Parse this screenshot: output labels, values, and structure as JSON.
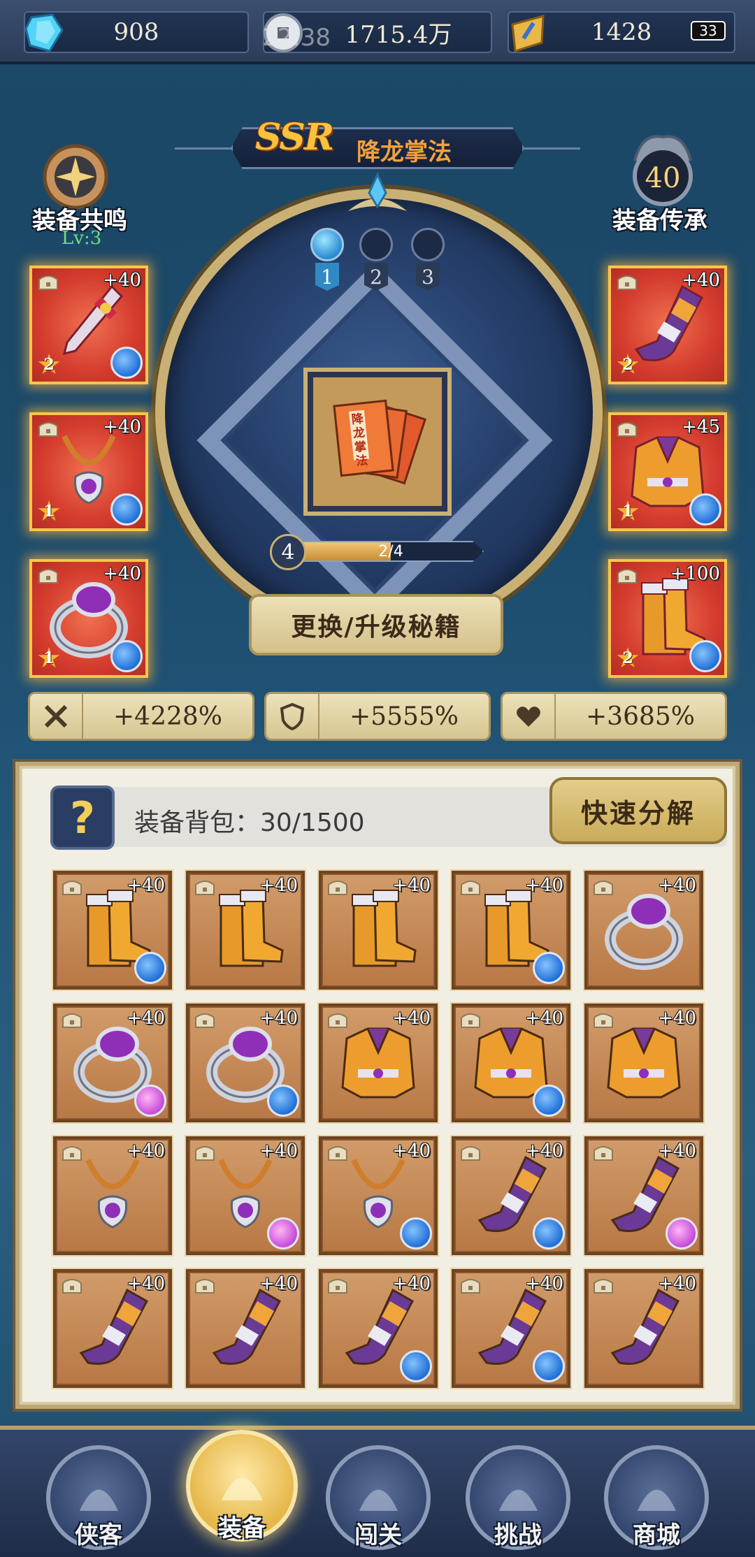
{
  "status": {
    "clock": "22:38",
    "battery": "33"
  },
  "resources": [
    {
      "name": "crystal",
      "icon": "crystal-icon",
      "value": "908"
    },
    {
      "name": "coin",
      "icon": "coin-icon",
      "value": "1715.4万"
    },
    {
      "name": "token",
      "icon": "scroll-token-icon",
      "value": "1428"
    }
  ],
  "header": {
    "rarity": "SSR",
    "book_name": "降龙掌法",
    "resonance_label": "装备共鸣",
    "resonance_level": "Lv:3",
    "inherit_label": "装备传承",
    "inherit_value": "40"
  },
  "gem_slots": [
    {
      "number": "1",
      "active": true
    },
    {
      "number": "2",
      "active": false
    },
    {
      "number": "3",
      "active": false
    }
  ],
  "book": {
    "cover_text": "降龙掌法",
    "level": "4",
    "progress_text": "2/4",
    "progress_fraction": 0.5,
    "upgrade_label": "更换/升级秘籍"
  },
  "equipped_left": [
    {
      "item": "sword",
      "plus": "+40",
      "stars": "2",
      "orb": "blue"
    },
    {
      "item": "necklace",
      "plus": "+40",
      "stars": "1",
      "orb": "blue"
    },
    {
      "item": "ring",
      "plus": "+40",
      "stars": "1",
      "orb": "blue"
    }
  ],
  "equipped_right": [
    {
      "item": "bracer",
      "plus": "+40",
      "stars": "2",
      "orb": "none"
    },
    {
      "item": "armor",
      "plus": "+45",
      "stars": "1",
      "orb": "blue"
    },
    {
      "item": "boots",
      "plus": "+100",
      "stars": "2",
      "orb": "blue"
    }
  ],
  "stats": [
    {
      "icon": "crossed-swords-icon",
      "value": "+4228%"
    },
    {
      "icon": "shield-icon",
      "value": "+5555%"
    },
    {
      "icon": "heart-icon",
      "value": "+3685%"
    }
  ],
  "bag": {
    "help": "?",
    "count_label": "装备背包：30/1500",
    "decompose_label": "快速分解",
    "items": [
      {
        "item": "boots",
        "plus": "+40",
        "orb": "blue"
      },
      {
        "item": "boots",
        "plus": "+40",
        "orb": "none"
      },
      {
        "item": "boots",
        "plus": "+40",
        "orb": "none"
      },
      {
        "item": "boots",
        "plus": "+40",
        "orb": "blue"
      },
      {
        "item": "ring",
        "plus": "+40",
        "orb": "none"
      },
      {
        "item": "ring",
        "plus": "+40",
        "orb": "pink"
      },
      {
        "item": "ring",
        "plus": "+40",
        "orb": "blue"
      },
      {
        "item": "armor",
        "plus": "+40",
        "orb": "none"
      },
      {
        "item": "armor",
        "plus": "+40",
        "orb": "blue"
      },
      {
        "item": "armor",
        "plus": "+40",
        "orb": "none"
      },
      {
        "item": "necklace",
        "plus": "+40",
        "orb": "none"
      },
      {
        "item": "necklace",
        "plus": "+40",
        "orb": "pink"
      },
      {
        "item": "necklace",
        "plus": "+40",
        "orb": "blue"
      },
      {
        "item": "bracer",
        "plus": "+40",
        "orb": "blue"
      },
      {
        "item": "bracer",
        "plus": "+40",
        "orb": "pink"
      },
      {
        "item": "bracer",
        "plus": "+40",
        "orb": "none"
      },
      {
        "item": "bracer",
        "plus": "+40",
        "orb": "none"
      },
      {
        "item": "bracer",
        "plus": "+40",
        "orb": "blue"
      },
      {
        "item": "bracer",
        "plus": "+40",
        "orb": "blue"
      },
      {
        "item": "bracer",
        "plus": "+40",
        "orb": "none"
      }
    ]
  },
  "nav": [
    {
      "label": "侠客",
      "icon": "hero-icon",
      "active": false
    },
    {
      "label": "装备",
      "icon": "armor-icon",
      "active": true
    },
    {
      "label": "闯关",
      "icon": "sword-stage-icon",
      "active": false
    },
    {
      "label": "挑战",
      "icon": "demon-mask-icon",
      "active": false
    },
    {
      "label": "商城",
      "icon": "shop-gate-icon",
      "active": false
    }
  ]
}
